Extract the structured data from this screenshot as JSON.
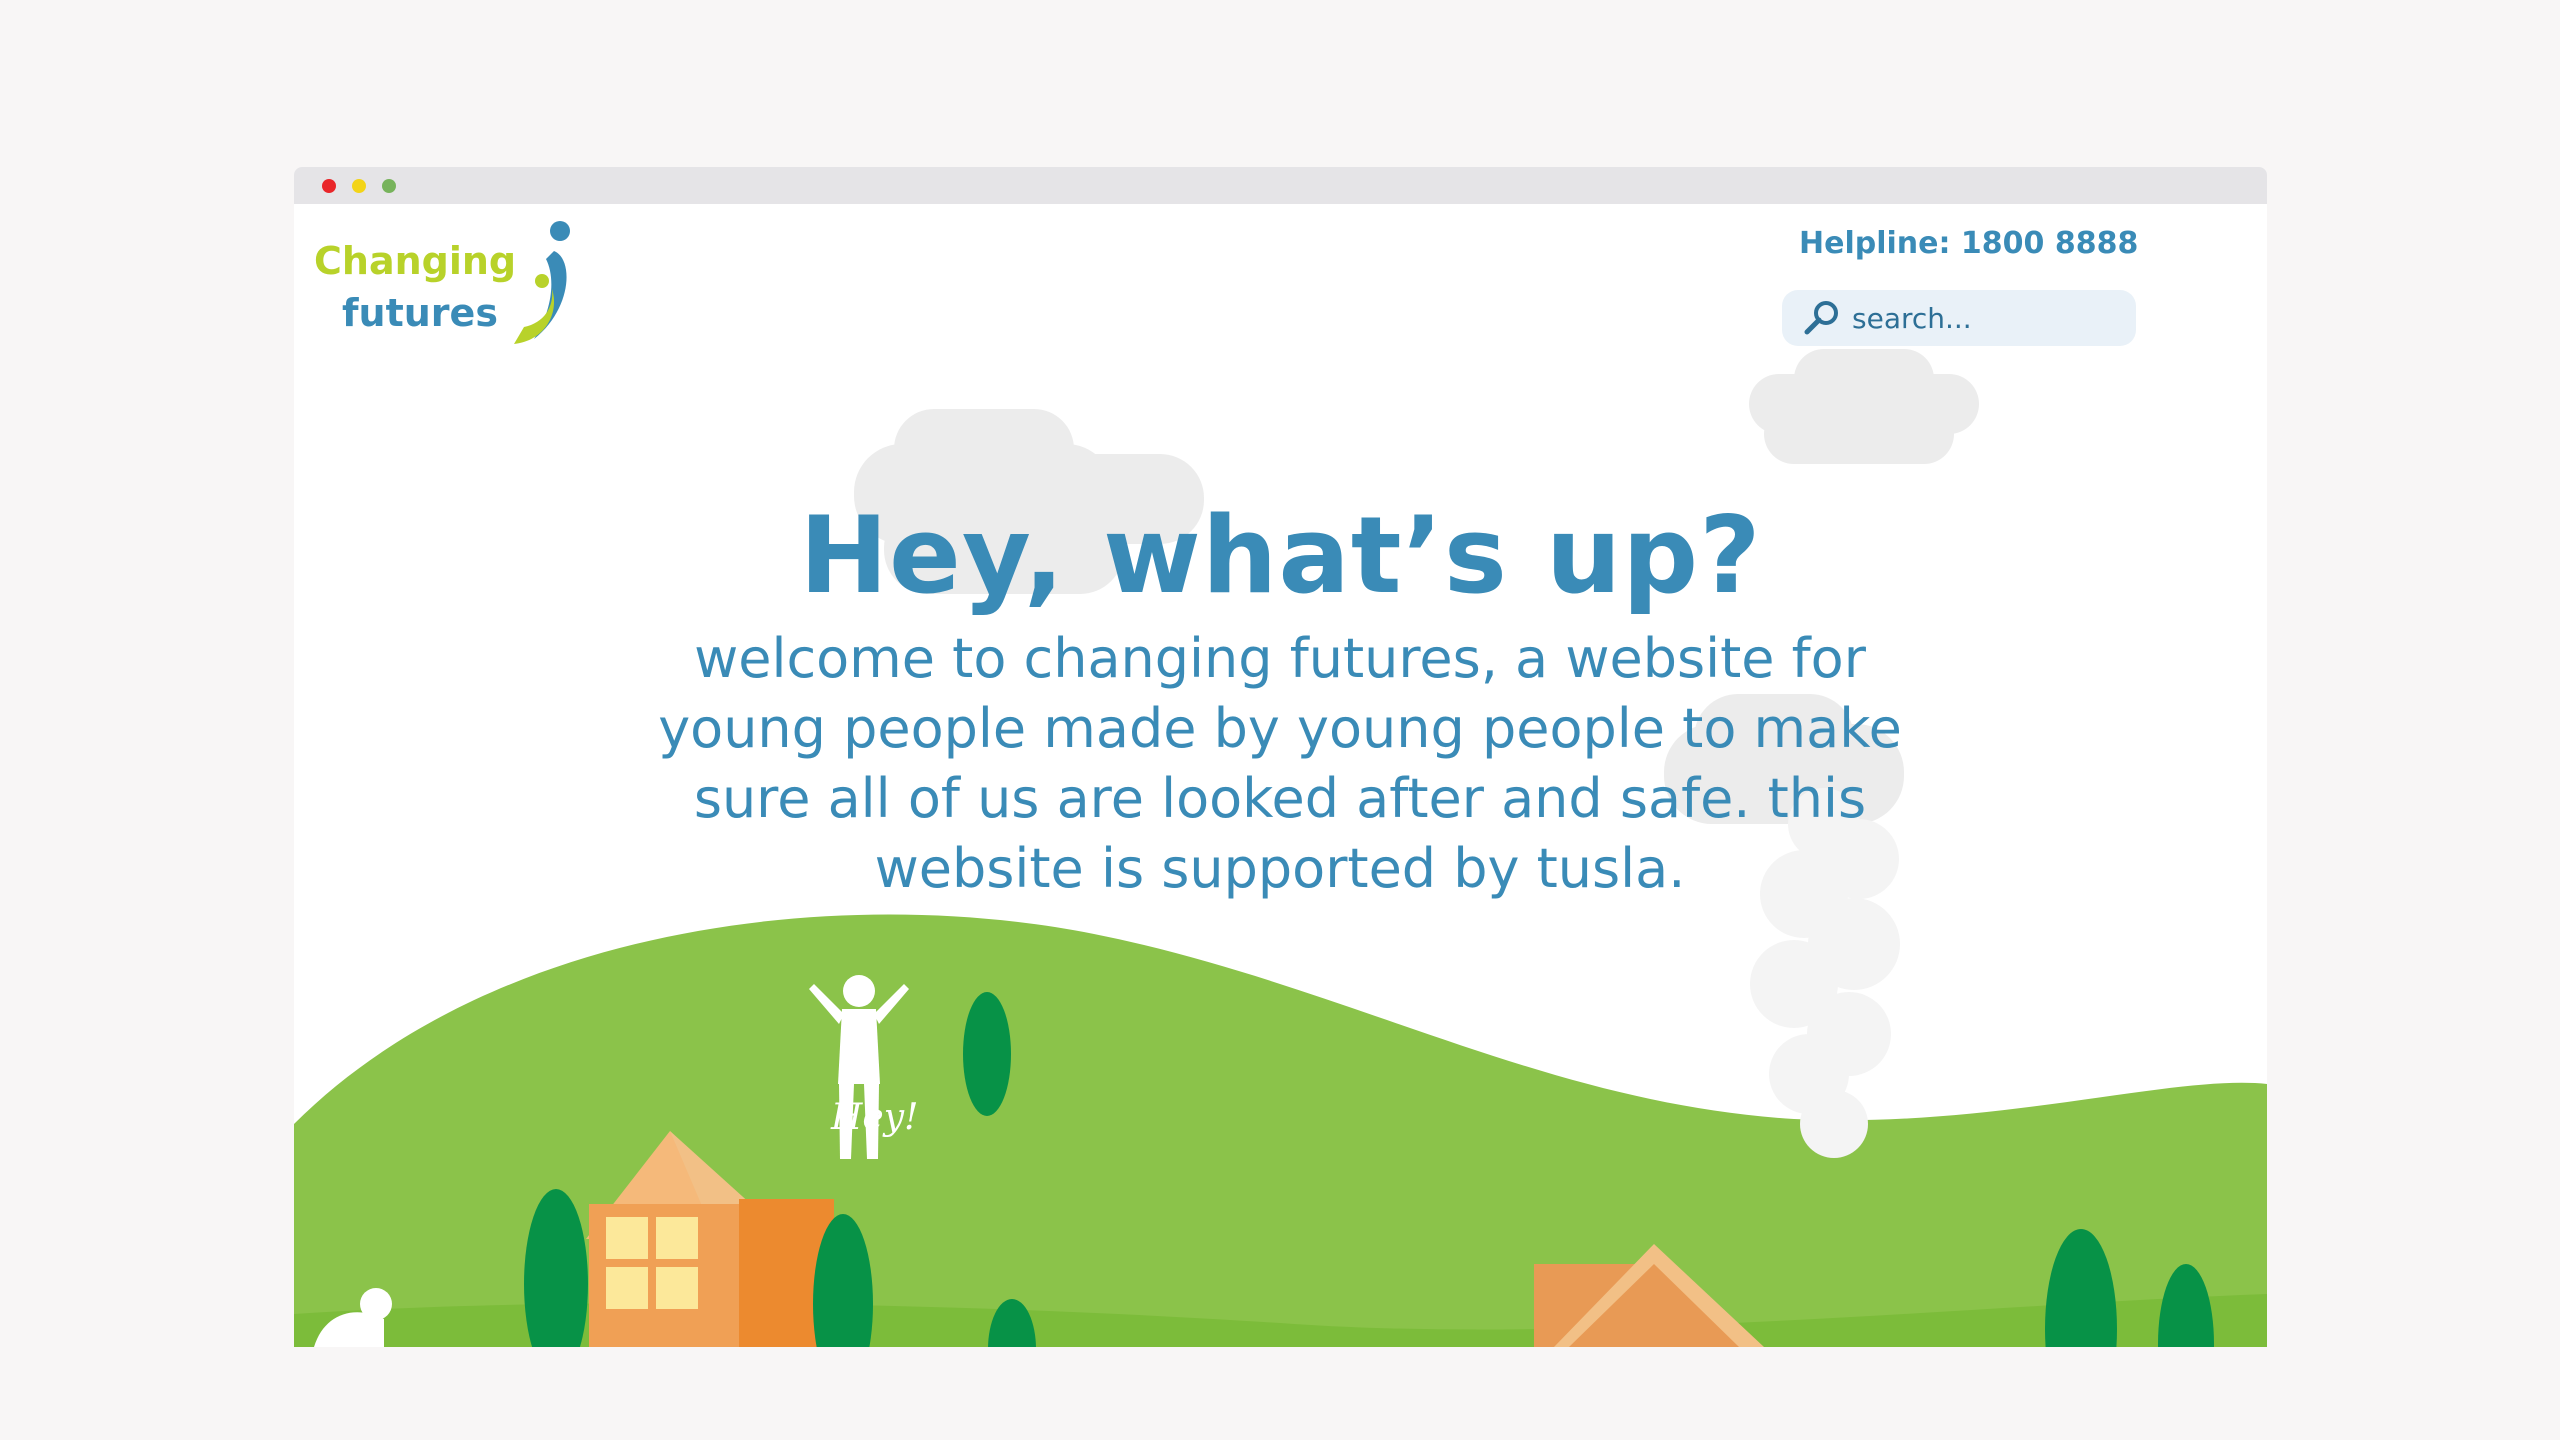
{
  "header": {
    "logo_line1": "Changing",
    "logo_line2": "futures",
    "helpline": "Helpline: 1800 8888",
    "search_placeholder": "search..."
  },
  "hero": {
    "title": "Hey, what’s up?",
    "description": "welcome to changing futures, a website for young people made by young people to make sure all of us are looked after and safe. this website is supported by tusla."
  },
  "illustration": {
    "greeting": "Hey!"
  },
  "colors": {
    "brand_blue": "#3a8bb7",
    "brand_green": "#b8d22a",
    "hill_green": "#8bc34a",
    "tree_green": "#079247",
    "house_orange": "#ef9a45"
  }
}
